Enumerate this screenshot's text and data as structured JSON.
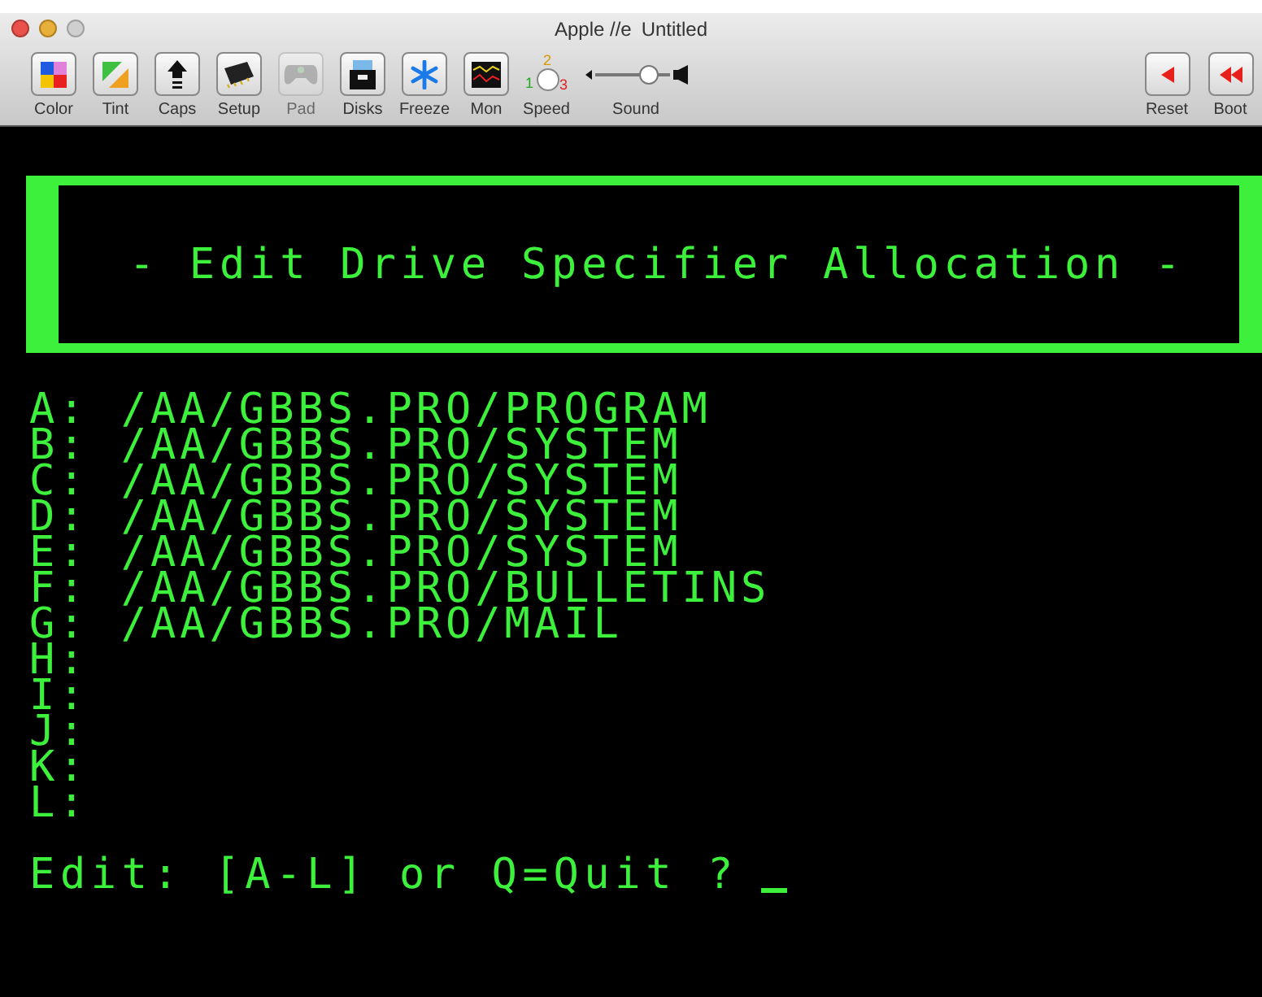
{
  "window": {
    "title": "Apple //e",
    "document": "Untitled"
  },
  "toolbar": [
    {
      "label": "Color",
      "disabled": false
    },
    {
      "label": "Tint",
      "disabled": false
    },
    {
      "label": "Caps",
      "disabled": false
    },
    {
      "label": "Setup",
      "disabled": false
    },
    {
      "label": "Pad",
      "disabled": true
    },
    {
      "label": "Disks",
      "disabled": false
    },
    {
      "label": "Freeze",
      "disabled": false
    },
    {
      "label": "Mon",
      "disabled": false
    }
  ],
  "speed": {
    "label": "Speed",
    "marks": [
      "1",
      "2",
      "3"
    ]
  },
  "sound": {
    "label": "Sound",
    "level": 0.8
  },
  "right_buttons": [
    {
      "label": "Reset"
    },
    {
      "label": "Boot"
    }
  ],
  "screen": {
    "heading": "- Edit Drive Specifier Allocation -",
    "drives": [
      {
        "letter": "A:",
        "path": "/AA/GBBS.PRO/PROGRAM"
      },
      {
        "letter": "B:",
        "path": "/AA/GBBS.PRO/SYSTEM"
      },
      {
        "letter": "C:",
        "path": "/AA/GBBS.PRO/SYSTEM"
      },
      {
        "letter": "D:",
        "path": "/AA/GBBS.PRO/SYSTEM"
      },
      {
        "letter": "E:",
        "path": "/AA/GBBS.PRO/SYSTEM"
      },
      {
        "letter": "F:",
        "path": "/AA/GBBS.PRO/BULLETINS"
      },
      {
        "letter": "G:",
        "path": "/AA/GBBS.PRO/MAIL"
      },
      {
        "letter": "H:"
      },
      {
        "letter": "I:"
      },
      {
        "letter": "J:"
      },
      {
        "letter": "K:"
      },
      {
        "letter": "L:"
      }
    ],
    "prompt": "Edit: [A-L] or Q=Quit ?"
  }
}
